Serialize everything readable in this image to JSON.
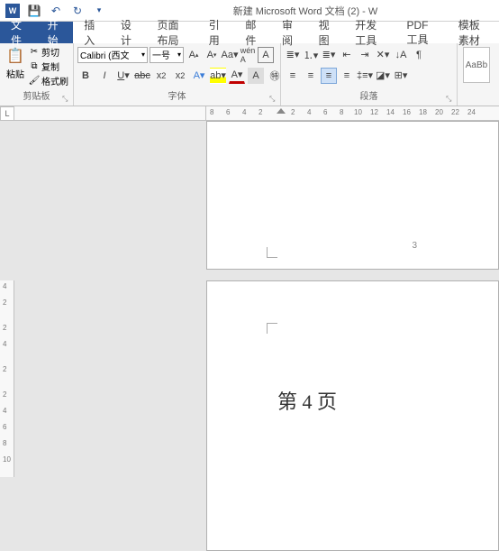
{
  "titlebar": {
    "title": "新建 Microsoft Word 文档 (2) - W"
  },
  "tabs": {
    "file": "文件",
    "home": "开始",
    "insert": "插入",
    "design": "设计",
    "layout": "页面布局",
    "references": "引用",
    "mailings": "邮件",
    "review": "审阅",
    "view": "视图",
    "developer": "开发工具",
    "pdf": "PDF工具",
    "templates": "模板素材"
  },
  "clipboard": {
    "paste": "粘贴",
    "cut": "剪切",
    "copy": "复制",
    "formatPainter": "格式刷",
    "groupLabel": "剪贴板"
  },
  "font": {
    "name": "Calibri (西文",
    "size": "一号",
    "groupLabel": "字体"
  },
  "paragraph": {
    "groupLabel": "段落"
  },
  "styles": {
    "preview": "AaBb"
  },
  "ruler": {
    "corner": "L",
    "hticks": [
      "8",
      "6",
      "4",
      "2",
      "2",
      "4",
      "6",
      "8",
      "10",
      "12",
      "14",
      "16",
      "18",
      "20",
      "22",
      "24"
    ],
    "vticks": [
      "4",
      "2",
      "2",
      "4",
      "2",
      "2",
      "4",
      "6",
      "8",
      "10"
    ]
  },
  "page1": {
    "num": "3"
  },
  "page2": {
    "text": "第 4 页"
  }
}
